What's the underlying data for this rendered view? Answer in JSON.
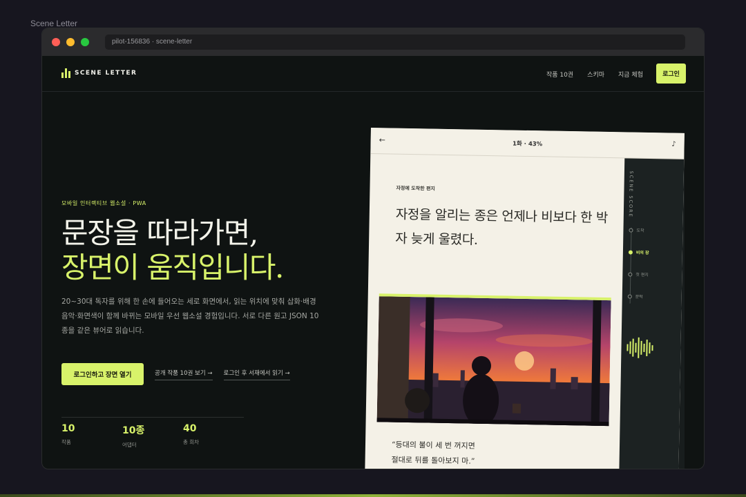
{
  "page_label": "Scene Letter",
  "browser": {
    "url": "pilot-156836 · scene-letter"
  },
  "nav": {
    "brand": "SCENE LETTER",
    "links": [
      "작품 10권",
      "스키마",
      "지금 체험"
    ],
    "login": "로그인"
  },
  "hero": {
    "eyebrow": "모바일 인터랙티브 웹소설 · PWA",
    "headline_1": "문장을 따라가면,",
    "headline_2": "장면이 움직입니다.",
    "description": "20~30대 독자를 위해 한 손에 들어오는 세로 화면에서, 읽는 위치에 맞춰 삽화·배경음악·화면색이 함께 바뀌는 모바일 우선 웹소설 경험입니다. 서로 다른 원고 JSON 10종을 같은 뷰어로 읽습니다.",
    "cta_primary": "로그인하고 장면 열기",
    "cta_link_1": "공개 작품 10권 보기 →",
    "cta_link_2": "로그인 후 서재에서 읽기 →"
  },
  "stats": [
    {
      "num": "10",
      "label": "작품"
    },
    {
      "num": "10종",
      "label": "어댑터"
    },
    {
      "num": "40",
      "label": "총 회차"
    }
  ],
  "reader": {
    "progress": "1화 · 43%",
    "chapter": "자정에 도착한 편지",
    "passage": "자정을 알리는 종은 언제나 비보다 한 박자 늦게 울렸다.",
    "quote_1": "“등대의 불이 세 번 꺼지면",
    "quote_2": "절대로 뒤를 돌아보지 마.”",
    "score_title": "SCENE SCORE",
    "timeline": [
      "도착",
      "비의 장",
      "첫 편지",
      "문턱"
    ],
    "active_index": 1
  },
  "colors": {
    "accent": "#d8f26a",
    "background": "#0f1312"
  }
}
